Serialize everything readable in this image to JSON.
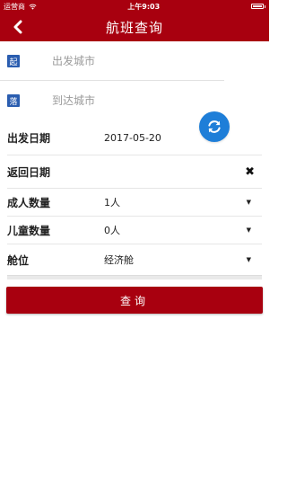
{
  "status_bar": {
    "carrier": "运营商",
    "time": "上午9:03"
  },
  "nav": {
    "title": "航班查询"
  },
  "from_city": {
    "tag": "起",
    "placeholder": "出发城市",
    "value": ""
  },
  "to_city": {
    "tag": "落",
    "placeholder": "到达城市",
    "value": ""
  },
  "form": {
    "depart_date": {
      "label": "出发日期",
      "value": "2017-05-20"
    },
    "return_date": {
      "label": "返回日期",
      "value": ""
    },
    "adults": {
      "label": "成人数量",
      "value": "1人"
    },
    "children": {
      "label": "儿童数量",
      "value": "0人"
    },
    "cabin": {
      "label": "舱位",
      "value": "经济舱"
    }
  },
  "search_button": {
    "label": "查询"
  },
  "colors": {
    "brand": "#a8000f",
    "tag": "#2a5db0",
    "swap": "#1e7ed8"
  },
  "icons": {
    "back": "chevron-left-icon",
    "swap": "refresh-icon",
    "clear": "close-icon",
    "dropdown": "caret-down-icon"
  }
}
